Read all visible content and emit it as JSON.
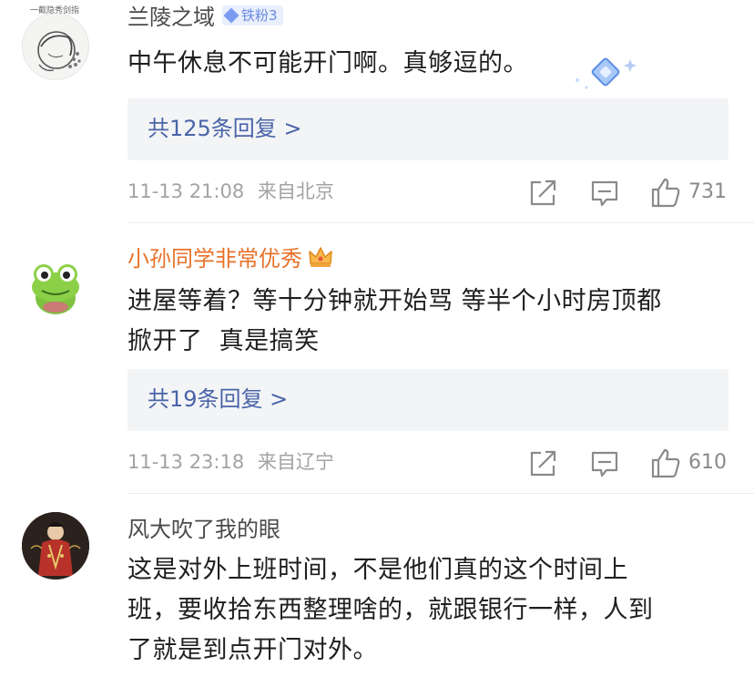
{
  "comments": [
    {
      "username": "兰陵之域",
      "badge": "铁粉3",
      "text": "中午休息不可能开门啊。真够逗的。",
      "replies": "共125条回复 >",
      "time": "11-13 21:08",
      "location": "来自北京",
      "likes": "731",
      "avatar_caption": "一截隐秀剑指"
    },
    {
      "username": "小孙同学非常优秀",
      "text_lines": [
        "进屋等着？等十分钟就开始骂 等半个小时房顶都",
        "掀开了  真是搞笑"
      ],
      "replies": "共19条回复 >",
      "time": "11-13 23:18",
      "location": "来自辽宁",
      "likes": "610"
    },
    {
      "username": "风大吹了我的眼",
      "text_lines": [
        "这是对外上班时间，不是他们真的这个时间上",
        "班，要收拾东西整理啥的，就跟银行一样，人到",
        "了就是到点开门对外。"
      ]
    }
  ],
  "colors": {
    "vip_name": "#e8722a",
    "reply_link": "#4a64a8",
    "meta_text": "#a3a3a3",
    "iron_badge": "#6b8be0"
  },
  "icons": [
    "share-icon",
    "comment-icon",
    "like-icon",
    "crown-icon",
    "diamond-sticker-icon"
  ]
}
